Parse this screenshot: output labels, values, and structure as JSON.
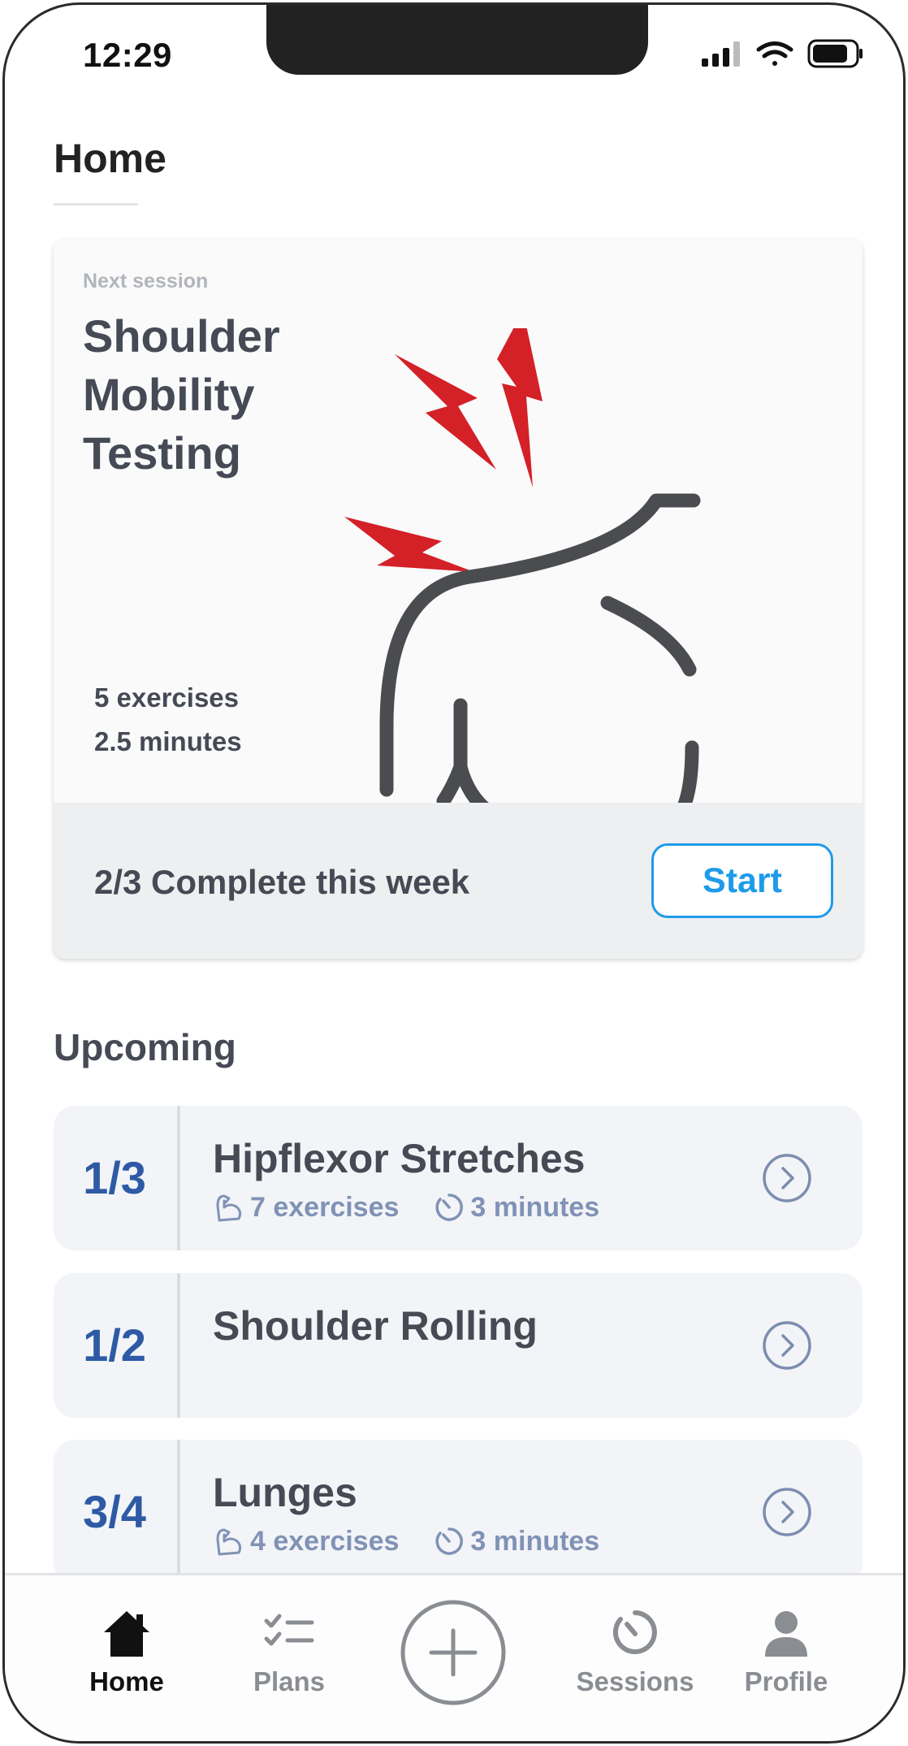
{
  "status_bar": {
    "time": "12:29"
  },
  "header": {
    "title": "Home"
  },
  "next_session": {
    "label": "Next session",
    "title": "Shoulder Mobility Testing",
    "exercises": "5 exercises",
    "duration": "2.5 minutes",
    "progress_text": "2/3 Complete this week",
    "start_label": "Start"
  },
  "upcoming": {
    "title": "Upcoming",
    "items": [
      {
        "count": "1/3",
        "name": "Hipflexor Stretches",
        "exercises": "7 exercises",
        "duration": "3 minutes"
      },
      {
        "count": "1/2",
        "name": "Shoulder Rolling"
      },
      {
        "count": "3/4",
        "name": "Lunges",
        "exercises": "4 exercises",
        "duration": "3 minutes"
      }
    ]
  },
  "tabbar": {
    "items": [
      {
        "label": "Home",
        "icon": "home-icon",
        "active": true
      },
      {
        "label": "Plans",
        "icon": "checklist-icon"
      },
      {
        "label": "",
        "icon": "plus-circle-icon"
      },
      {
        "label": "Sessions",
        "icon": "timer-icon"
      },
      {
        "label": "Profile",
        "icon": "person-icon"
      }
    ]
  },
  "colors": {
    "accent": "#1e9be9",
    "count_blue": "#2e5aa5",
    "pain_red": "#d42027",
    "text": "#454a55"
  }
}
